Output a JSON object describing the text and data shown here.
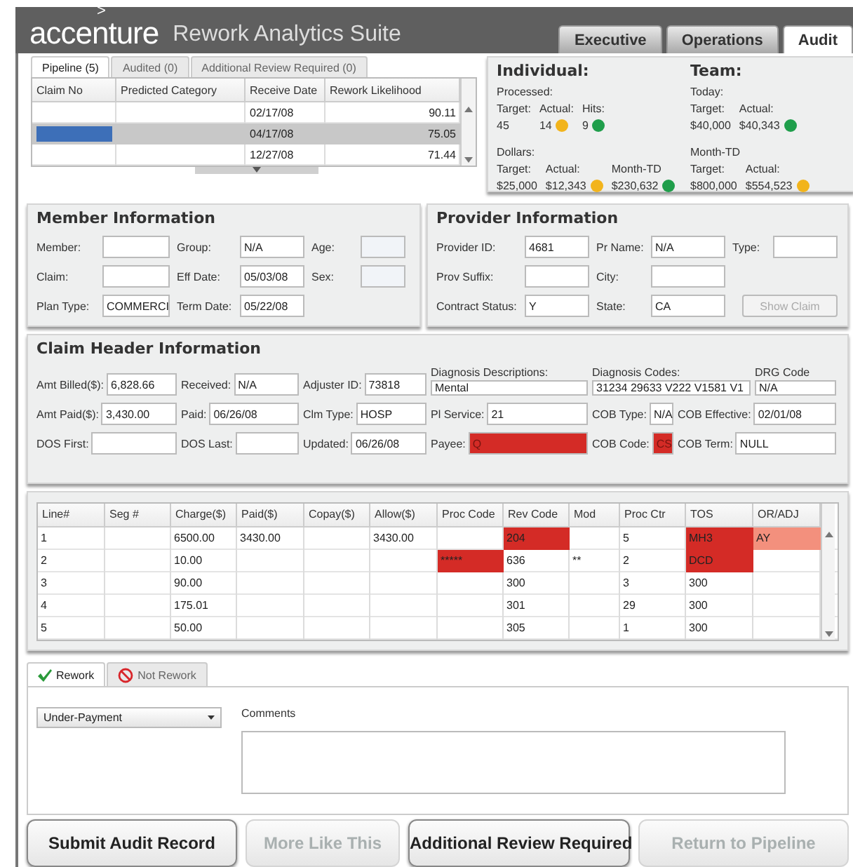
{
  "header": {
    "logo_mark": ">",
    "logo": "accenture",
    "title": "Rework Analytics Suite",
    "tabs": [
      {
        "label": "Executive",
        "selected": false
      },
      {
        "label": "Operations",
        "selected": false
      },
      {
        "label": "Audit",
        "selected": true
      }
    ]
  },
  "pipeline": {
    "tabs": [
      {
        "label": "Pipeline (5)",
        "selected": true
      },
      {
        "label": "Audited (0)",
        "selected": false
      },
      {
        "label": "Additional Review Required (0)",
        "selected": false
      }
    ],
    "columns": [
      "Claim No",
      "Predicted Category",
      "Receive Date",
      "Rework Likelihood"
    ],
    "rows": [
      {
        "receive_date": "02/17/08",
        "rework_likelihood": "90.11",
        "selected": false
      },
      {
        "receive_date": "04/17/08",
        "rework_likelihood": "75.05",
        "selected": true
      },
      {
        "receive_date": "12/27/08",
        "rework_likelihood": "71.44",
        "selected": false
      }
    ]
  },
  "metrics": [
    {
      "title": "Individual:",
      "groups": [
        {
          "label": "Processed:",
          "items": [
            {
              "label": "Target:",
              "value": "45"
            },
            {
              "label": "Actual:",
              "value": "14",
              "color": "#f2b41c"
            },
            {
              "label": "Hits:",
              "value": "9",
              "color": "#1f9e4b"
            }
          ]
        },
        {
          "label": "Dollars:",
          "items": [
            {
              "label": "Target:",
              "value": "$25,000"
            },
            {
              "label": "Actual:",
              "value": "$12,343",
              "color": "#f2b41c"
            },
            {
              "label": "Month-TD",
              "value": "$230,632",
              "color": "#1f9e4b"
            }
          ]
        }
      ]
    },
    {
      "title": "Team:",
      "groups": [
        {
          "label": "Today:",
          "items": [
            {
              "label": "Target:",
              "value": "$40,000"
            },
            {
              "label": "Actual:",
              "value": "$40,343",
              "color": "#1f9e4b"
            }
          ]
        },
        {
          "label": "Month-TD",
          "items": [
            {
              "label": "Target:",
              "value": "$800,000"
            },
            {
              "label": "Actual:",
              "value": "$554,523",
              "color": "#f2b41c"
            }
          ]
        }
      ]
    }
  ],
  "member": {
    "title": "Member Information",
    "rows": [
      [
        {
          "label": "Member:"
        },
        {
          "label": "Group:",
          "value": "N/A"
        },
        {
          "label": "Age:",
          "disabled": true
        }
      ],
      [
        {
          "label": "Claim:"
        },
        {
          "label": "Eff Date:",
          "value": "05/03/08"
        },
        {
          "label": "Sex:",
          "disabled": true
        }
      ],
      [
        {
          "label": "Plan Type:",
          "value": "COMMERCI"
        },
        {
          "label": "Term Date:",
          "value": "05/22/08"
        }
      ]
    ]
  },
  "provider": {
    "title": "Provider Information",
    "rows": [
      [
        {
          "label": "Provider ID:",
          "value": "4681"
        },
        {
          "label": "Pr Name:",
          "value": "N/A"
        },
        {
          "label": "Type:"
        }
      ],
      [
        {
          "label": "Prov Suffix:"
        },
        {
          "label": "City:"
        }
      ],
      [
        {
          "label": "Contract Status:",
          "value": "Y"
        },
        {
          "label": "State:",
          "value": "CA"
        }
      ]
    ],
    "button": {
      "label": "Show Claim",
      "disabled": true
    }
  },
  "claim_header": {
    "title": "Claim Header Information",
    "rows": [
      [
        {
          "kind": "inline",
          "label": "Amt Billed($):",
          "value": "6,828.66"
        },
        {
          "kind": "inline",
          "label": "Received:",
          "value": "N/A"
        },
        {
          "kind": "inline",
          "label": "Adjuster ID:",
          "value": "73818"
        },
        {
          "kind": "stacked",
          "label": "Diagnosis Descriptions:",
          "value": "Mental"
        },
        {
          "kind": "stacked",
          "label": "Diagnosis Codes:",
          "value": "31234 29633 V222 V1581 V1"
        },
        {
          "kind": "stacked",
          "label": "DRG Code",
          "value": "N/A"
        }
      ],
      [
        {
          "kind": "inline",
          "label": "Amt Paid($):",
          "value": "3,430.00"
        },
        {
          "kind": "inline",
          "label": "Paid:",
          "value": "06/26/08"
        },
        {
          "kind": "inline",
          "label": "Clm Type:",
          "value": "HOSP"
        },
        {
          "kind": "inline",
          "label": "Pl Service:",
          "value": "21"
        },
        {
          "kind": "inline",
          "label": "COB Type:",
          "value": "N/A"
        },
        {
          "kind": "inline",
          "label": "COB Effective:",
          "value": "02/01/08"
        }
      ],
      [
        {
          "kind": "inline",
          "label": "DOS First:"
        },
        {
          "kind": "inline",
          "label": "DOS Last:"
        },
        {
          "kind": "inline",
          "label": "Updated:",
          "value": "06/26/08"
        },
        {
          "kind": "inline",
          "label": "Payee:",
          "value": "Q",
          "alert": true
        },
        {
          "kind": "inline",
          "label": "COB Code:",
          "value": "CS",
          "alert": true
        },
        {
          "kind": "inline",
          "label": "COB Term:",
          "value": "NULL"
        }
      ]
    ]
  },
  "lines": {
    "columns": [
      "Line#",
      "Seg #",
      "Charge($)",
      "Paid($)",
      "Copay($)",
      "Allow($)",
      "Proc Code",
      "Rev Code",
      "Mod",
      "Proc Ctr",
      "TOS",
      "OR/ADJ"
    ],
    "rows": [
      [
        {
          "text": "1"
        },
        {},
        {
          "text": "6500.00"
        },
        {
          "text": "3430.00"
        },
        {},
        {
          "text": "3430.00"
        },
        {},
        {
          "text": "204",
          "color": "#d42b26"
        },
        {},
        {
          "text": "5"
        },
        {
          "text": "MH3",
          "color": "#d42b26"
        },
        {
          "text": "AY",
          "color": "#f3907d"
        }
      ],
      [
        {
          "text": "2"
        },
        {},
        {
          "text": "10.00"
        },
        {},
        {},
        {},
        {
          "text": "*****",
          "color": "#d42b26"
        },
        {
          "text": "636"
        },
        {
          "text": "**"
        },
        {
          "text": "2"
        },
        {
          "text": "DCD",
          "color": "#d42b26"
        },
        {}
      ],
      [
        {
          "text": "3"
        },
        {},
        {
          "text": "90.00"
        },
        {},
        {},
        {},
        {},
        {
          "text": "300"
        },
        {},
        {
          "text": "3"
        },
        {
          "text": "300"
        },
        {}
      ],
      [
        {
          "text": "4"
        },
        {},
        {
          "text": "175.01"
        },
        {},
        {},
        {},
        {},
        {
          "text": "301"
        },
        {},
        {
          "text": "29"
        },
        {
          "text": "300"
        },
        {}
      ],
      [
        {
          "text": "5"
        },
        {},
        {
          "text": "50.00"
        },
        {},
        {},
        {},
        {},
        {
          "text": "305"
        },
        {},
        {
          "text": "1"
        },
        {
          "text": "300"
        },
        {}
      ]
    ]
  },
  "decision": {
    "tabs": [
      {
        "label": "Rework",
        "selected": true
      },
      {
        "label": "Not Rework",
        "selected": false
      }
    ],
    "category": "Under-Payment",
    "comments_label": "Comments"
  },
  "buttons": [
    {
      "label": "Submit Audit Record",
      "disabled": false
    },
    {
      "label": "More Like This",
      "disabled": true
    },
    {
      "label": "Additional Review Required",
      "disabled": false
    },
    {
      "label": "Return to Pipeline",
      "disabled": true
    }
  ]
}
